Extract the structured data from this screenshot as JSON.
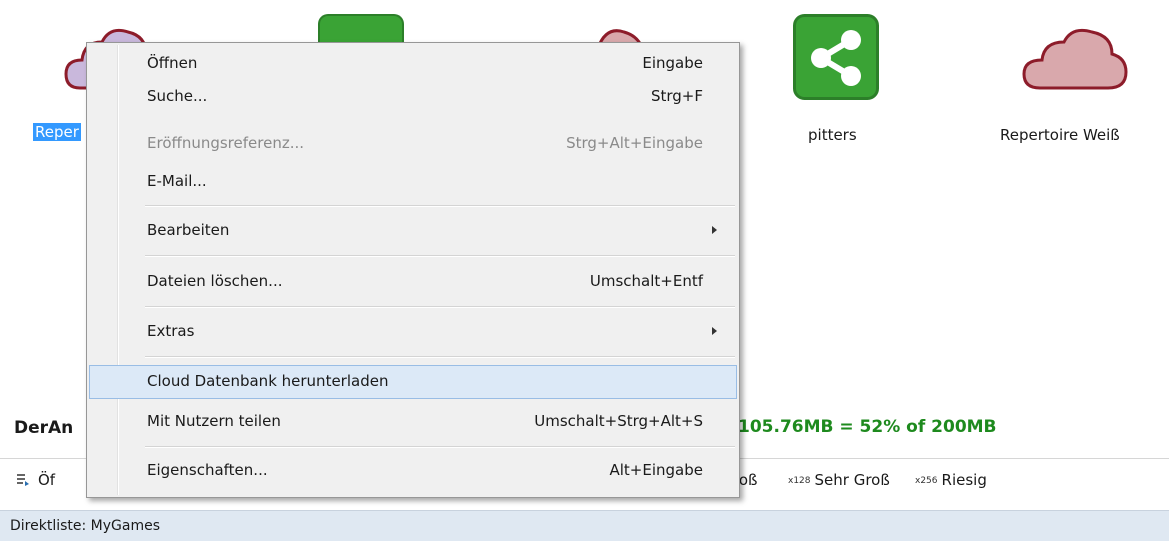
{
  "desktop": {
    "items": [
      {
        "label": "Reper",
        "type": "cloud",
        "color": "#c9b8dc",
        "selected": true
      },
      {
        "label": "",
        "type": "share",
        "color": "#3aa335"
      },
      {
        "label": "",
        "type": "cloud",
        "color": "#d9a8ac"
      },
      {
        "label": "pitters",
        "type": "share",
        "color": "#3aa335"
      },
      {
        "label": "Repertoire Weiß",
        "type": "cloud",
        "color": "#d9a8ac"
      }
    ]
  },
  "status": {
    "user": "DerAn",
    "quota": "105.76MB = 52% of 200MB",
    "quota_color": "#1e8a1e"
  },
  "toolbar": {
    "open_label": "Öf",
    "sizes": [
      {
        "badge": "",
        "label": "roß"
      },
      {
        "badge": "x128",
        "label": "Sehr Groß"
      },
      {
        "badge": "x256",
        "label": "Riesig"
      }
    ]
  },
  "statusbar": {
    "text": "Direktliste: MyGames"
  },
  "menu": {
    "items": [
      {
        "label": "Öffnen",
        "shortcut": "Eingabe"
      },
      {
        "label": "Suche...",
        "shortcut": "Strg+F"
      },
      {
        "label": "Eröffnungsreferenz...",
        "shortcut": "Strg+Alt+Eingabe",
        "disabled": true
      },
      {
        "label": "E-Mail...",
        "shortcut": ""
      },
      {
        "label": "Bearbeiten",
        "shortcut": "",
        "submenu": true
      },
      {
        "label": "Dateien löschen...",
        "shortcut": "Umschalt+Entf"
      },
      {
        "label": "Extras",
        "shortcut": "",
        "submenu": true
      },
      {
        "label": "Cloud Datenbank herunterladen",
        "shortcut": "",
        "highlighted": true
      },
      {
        "label": "Mit Nutzern teilen",
        "shortcut": "Umschalt+Strg+Alt+S"
      },
      {
        "label": "Eigenschaften...",
        "shortcut": "Alt+Eingabe"
      }
    ]
  }
}
